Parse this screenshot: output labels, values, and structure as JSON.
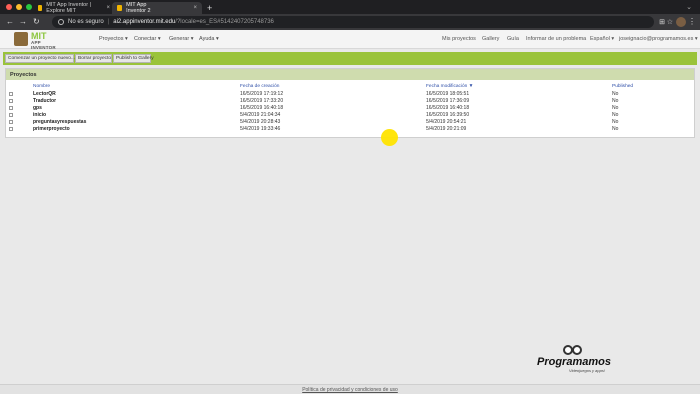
{
  "browser": {
    "tabs": [
      {
        "title": "MIT App Inventor | Explore MIT",
        "active": false
      },
      {
        "title": "MIT App Inventor 2",
        "active": true
      }
    ],
    "new_tab_glyph": "+",
    "tab_close_glyph": "×",
    "tab_list_glyph": "⌄",
    "nav": {
      "back": "←",
      "forward": "→",
      "reload": "↻"
    },
    "security_label": "No es seguro",
    "separator": "|",
    "url_host": "ai2.appinventor.mit.edu",
    "url_rest": "/?locale=es_ES#5142407205748736",
    "icons": [
      "info-icon",
      "translate-icon",
      "star-icon",
      "extension-icon",
      "profile-avatar",
      "kebab-menu-icon"
    ],
    "star_glyph": "☆",
    "kebab_glyph": "⋮"
  },
  "header": {
    "logo_mit": "MIT",
    "logo_sub": "APP INVENTOR",
    "menus": [
      "Proyectos ▾",
      "Conectar ▾",
      "Generar ▾",
      "Ayuda ▾"
    ],
    "links": [
      "Mis proyectos",
      "Gallery",
      "Guía",
      "Informar de un problema",
      "Español ▾",
      "joseignacio@programamos.es ▾"
    ]
  },
  "toolbar": {
    "buttons": [
      "Comenzar un proyecto nuevo...",
      "Borrar proyecto",
      "Publish to Gallery"
    ],
    "color": "#9ac33a"
  },
  "projects": {
    "title": "Proyectos",
    "columns": [
      "Nombre",
      "Fecha de creación",
      "Fecha modificación ▼",
      "Published"
    ],
    "rows": [
      {
        "name": "LectorQR",
        "created": "16/5/2019 17:19:12",
        "modified": "16/5/2019 18:05:51",
        "published": "No"
      },
      {
        "name": "Traductor",
        "created": "16/5/2019 17:33:20",
        "modified": "16/5/2019 17:36:09",
        "published": "No"
      },
      {
        "name": "gps",
        "created": "16/5/2019 16:40:18",
        "modified": "16/5/2019 16:40:18",
        "published": "No"
      },
      {
        "name": "inicio",
        "created": "5/4/2019 21:04:34",
        "modified": "16/5/2019 16:39:50",
        "published": "No"
      },
      {
        "name": "preguntasyrespuestas",
        "created": "5/4/2019 20:28:43",
        "modified": "5/4/2019 20:54:21",
        "published": "No"
      },
      {
        "name": "primerproyecto",
        "created": "5/4/2019 19:33:46",
        "modified": "5/4/2019 20:21:09",
        "published": "No"
      }
    ]
  },
  "footer": {
    "text": "Política de privacidad y condiciones de uso"
  },
  "watermark": {
    "brand": "Programamos",
    "tagline": "Videojuegos y apps!"
  }
}
